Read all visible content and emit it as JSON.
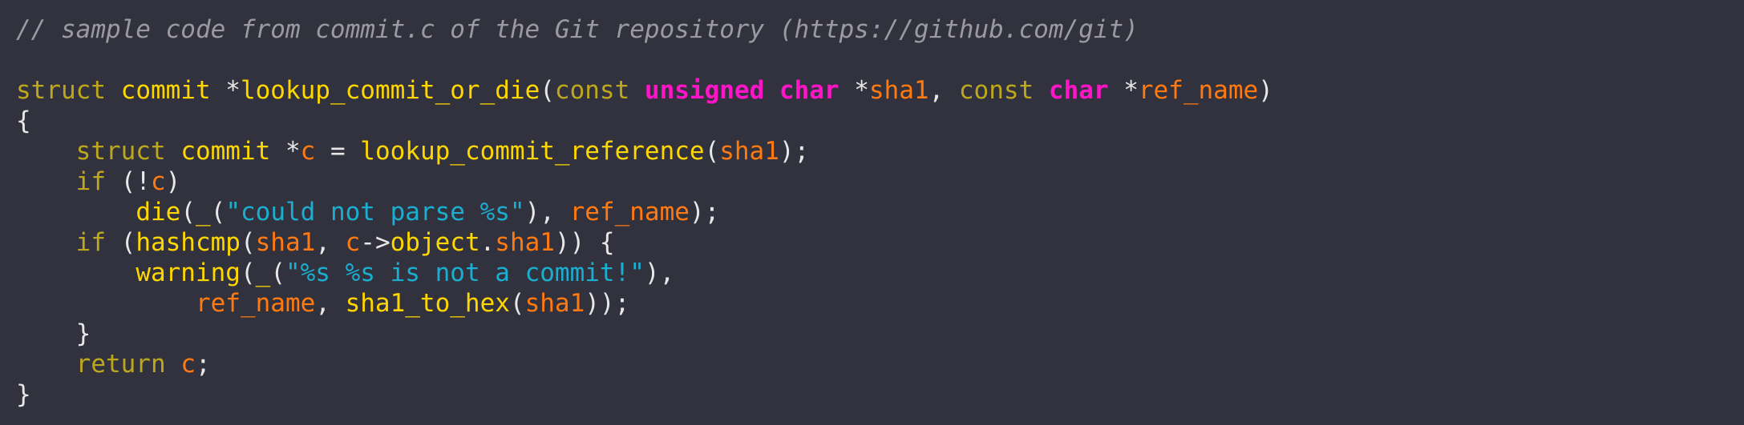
{
  "editor": {
    "lines": [
      [
        {
          "t": "// sample code from commit.c of the Git repository (https://github.com/git)",
          "k": "comment"
        }
      ],
      [],
      [
        {
          "t": "struct",
          "k": "keyword"
        },
        {
          "t": " ",
          "k": "punct"
        },
        {
          "t": "commit",
          "k": "func"
        },
        {
          "t": " *",
          "k": "punct"
        },
        {
          "t": "lookup_commit_or_die",
          "k": "func"
        },
        {
          "t": "(",
          "k": "punct"
        },
        {
          "t": "const",
          "k": "keyword"
        },
        {
          "t": " ",
          "k": "punct"
        },
        {
          "t": "unsigned char",
          "k": "type"
        },
        {
          "t": " *",
          "k": "punct"
        },
        {
          "t": "sha1",
          "k": "ident"
        },
        {
          "t": ", ",
          "k": "punct"
        },
        {
          "t": "const",
          "k": "keyword"
        },
        {
          "t": " ",
          "k": "punct"
        },
        {
          "t": "char",
          "k": "type"
        },
        {
          "t": " *",
          "k": "punct"
        },
        {
          "t": "ref_name",
          "k": "ident"
        },
        {
          "t": ")",
          "k": "punct"
        }
      ],
      [
        {
          "t": "{",
          "k": "punct"
        }
      ],
      [
        {
          "t": "    ",
          "k": "punct"
        },
        {
          "t": "struct",
          "k": "keyword"
        },
        {
          "t": " ",
          "k": "punct"
        },
        {
          "t": "commit",
          "k": "func"
        },
        {
          "t": " *",
          "k": "punct"
        },
        {
          "t": "c",
          "k": "ident"
        },
        {
          "t": " = ",
          "k": "punct"
        },
        {
          "t": "lookup_commit_reference",
          "k": "func"
        },
        {
          "t": "(",
          "k": "punct"
        },
        {
          "t": "sha1",
          "k": "ident"
        },
        {
          "t": ");",
          "k": "punct"
        }
      ],
      [
        {
          "t": "    ",
          "k": "punct"
        },
        {
          "t": "if",
          "k": "keyword"
        },
        {
          "t": " (!",
          "k": "punct"
        },
        {
          "t": "c",
          "k": "ident"
        },
        {
          "t": ")",
          "k": "punct"
        }
      ],
      [
        {
          "t": "        ",
          "k": "punct"
        },
        {
          "t": "die",
          "k": "func"
        },
        {
          "t": "(",
          "k": "punct"
        },
        {
          "t": "_",
          "k": "func"
        },
        {
          "t": "(",
          "k": "punct"
        },
        {
          "t": "\"could not parse %s\"",
          "k": "string"
        },
        {
          "t": "), ",
          "k": "punct"
        },
        {
          "t": "ref_name",
          "k": "ident"
        },
        {
          "t": ");",
          "k": "punct"
        }
      ],
      [
        {
          "t": "    ",
          "k": "punct"
        },
        {
          "t": "if",
          "k": "keyword"
        },
        {
          "t": " (",
          "k": "punct"
        },
        {
          "t": "hashcmp",
          "k": "func"
        },
        {
          "t": "(",
          "k": "punct"
        },
        {
          "t": "sha1",
          "k": "ident"
        },
        {
          "t": ", ",
          "k": "punct"
        },
        {
          "t": "c",
          "k": "ident"
        },
        {
          "t": "->",
          "k": "punct"
        },
        {
          "t": "object",
          "k": "func"
        },
        {
          "t": ".",
          "k": "punct"
        },
        {
          "t": "sha1",
          "k": "ident"
        },
        {
          "t": ")) {",
          "k": "punct"
        }
      ],
      [
        {
          "t": "        ",
          "k": "punct"
        },
        {
          "t": "warning",
          "k": "func"
        },
        {
          "t": "(",
          "k": "punct"
        },
        {
          "t": "_",
          "k": "func"
        },
        {
          "t": "(",
          "k": "punct"
        },
        {
          "t": "\"%s %s is not a commit!\"",
          "k": "string"
        },
        {
          "t": "),",
          "k": "punct"
        }
      ],
      [
        {
          "t": "            ",
          "k": "punct"
        },
        {
          "t": "ref_name",
          "k": "ident"
        },
        {
          "t": ", ",
          "k": "punct"
        },
        {
          "t": "sha1_to_hex",
          "k": "func"
        },
        {
          "t": "(",
          "k": "punct"
        },
        {
          "t": "sha1",
          "k": "ident"
        },
        {
          "t": "));",
          "k": "punct"
        }
      ],
      [
        {
          "t": "    }",
          "k": "punct"
        }
      ],
      [
        {
          "t": "    ",
          "k": "punct"
        },
        {
          "t": "return",
          "k": "keyword"
        },
        {
          "t": " ",
          "k": "punct"
        },
        {
          "t": "c",
          "k": "ident"
        },
        {
          "t": ";",
          "k": "punct"
        }
      ],
      [
        {
          "t": "}",
          "k": "punct"
        }
      ]
    ]
  },
  "colors": {
    "background": "#32323f",
    "comment": "#9a9aa0",
    "keyword": "#bda71d",
    "type": "#ff14c8",
    "function": "#ffd700",
    "identifier": "#ff7a10",
    "string": "#1aaed0",
    "text": "#e8e8e8"
  }
}
